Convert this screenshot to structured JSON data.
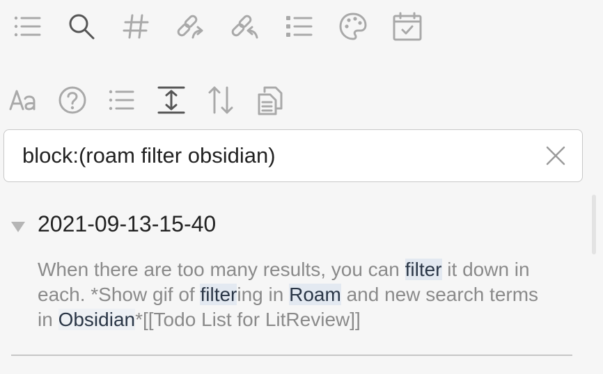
{
  "toolbar": {
    "row1": [
      {
        "name": "files-icon"
      },
      {
        "name": "search-icon",
        "active": true
      },
      {
        "name": "tag-icon"
      },
      {
        "name": "backlinks-icon"
      },
      {
        "name": "outgoing-links-icon"
      },
      {
        "name": "outline-icon"
      },
      {
        "name": "palette-icon"
      },
      {
        "name": "calendar-icon"
      }
    ],
    "row2": [
      {
        "name": "match-case-icon"
      },
      {
        "name": "explain-search-icon"
      },
      {
        "name": "collapse-results-icon"
      },
      {
        "name": "show-more-context-icon"
      },
      {
        "name": "sort-icon"
      },
      {
        "name": "copy-results-icon"
      }
    ]
  },
  "search": {
    "value": "block:(roam filter obsidian)",
    "clear_icon": "close-icon"
  },
  "results": [
    {
      "file": "2021-09-13-15-40",
      "snippet": [
        {
          "text": "When there are too many results, you can "
        },
        {
          "text": "filter",
          "highlight": true
        },
        {
          "text": " it down in each. *Show gif of "
        },
        {
          "text": "filter",
          "highlight": true
        },
        {
          "text": "ing in "
        },
        {
          "text": "Roam",
          "highlight": true
        },
        {
          "text": " and new search terms in "
        },
        {
          "text": "Obsidian",
          "highlight": true,
          "faint": true
        },
        {
          "text": "*[[Todo List for LitReview]]"
        }
      ]
    }
  ],
  "colors": {
    "background": "#f6f6f6",
    "icon": "#a9a9a9",
    "icon_active": "#555555",
    "highlight": "#e3e9f1"
  }
}
